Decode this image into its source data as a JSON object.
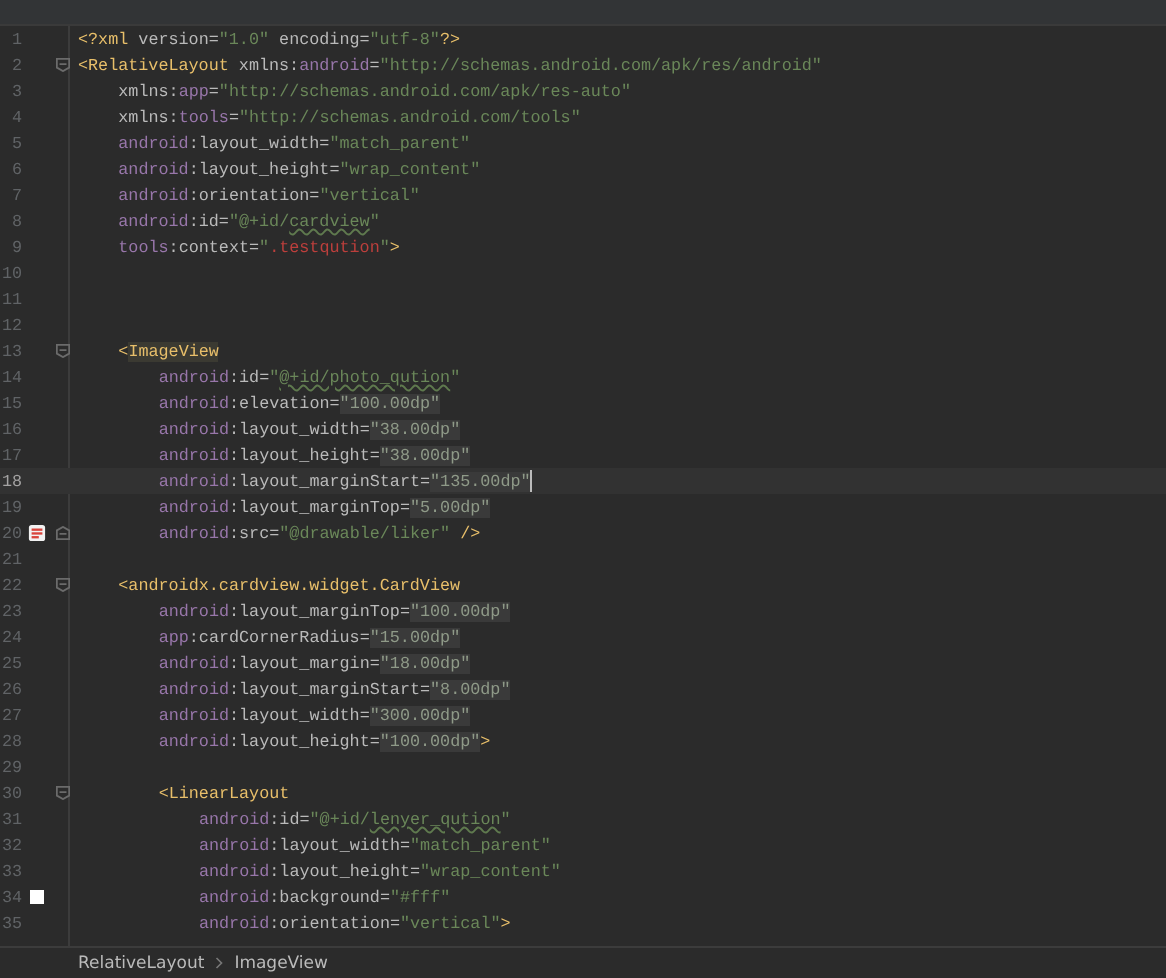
{
  "editor": {
    "lines": [
      {
        "number": "1",
        "kind": "plain",
        "current": false,
        "tokens": [
          {
            "kind": "tag",
            "text": "<?xml"
          },
          {
            "kind": "attr",
            "text": " version="
          },
          {
            "kind": "value",
            "text": "\"1.0\""
          },
          {
            "kind": "attr",
            "text": " encoding="
          },
          {
            "kind": "value",
            "text": "\"utf-8\""
          },
          {
            "kind": "tag",
            "text": "?>"
          }
        ]
      },
      {
        "number": "2",
        "kind": "opening",
        "current": false,
        "tokens": [
          {
            "kind": "tag",
            "text": "<RelativeLayout"
          },
          {
            "kind": "attr",
            "text": " xmlns:"
          },
          {
            "kind": "ns",
            "text": "android"
          },
          {
            "kind": "attr",
            "text": "="
          },
          {
            "kind": "value",
            "text": "\"http://schemas.android.com/apk/res/android\""
          }
        ],
        "children": [
          {
            "number": "3",
            "kind": "plain",
            "current": false,
            "tokens": [
              {
                "kind": "attr",
                "text": "xmlns:"
              },
              {
                "kind": "ns",
                "text": "app"
              },
              {
                "kind": "attr",
                "text": "="
              },
              {
                "kind": "value",
                "text": "\"http://schemas.android.com/apk/res-auto\""
              }
            ]
          },
          {
            "number": "4",
            "kind": "plain",
            "current": false,
            "tokens": [
              {
                "kind": "attr",
                "text": "xmlns:"
              },
              {
                "kind": "ns",
                "text": "tools"
              },
              {
                "kind": "attr",
                "text": "="
              },
              {
                "kind": "value",
                "text": "\"http://schemas.android.com/tools\""
              }
            ]
          },
          {
            "number": "5",
            "kind": "plain",
            "current": false,
            "tokens": [
              {
                "kind": "ns",
                "text": "android"
              },
              {
                "kind": "attr",
                "text": ":layout_width="
              },
              {
                "kind": "value",
                "text": "\"match_parent\""
              }
            ]
          },
          {
            "number": "6",
            "kind": "plain",
            "current": false,
            "tokens": [
              {
                "kind": "ns",
                "text": "android"
              },
              {
                "kind": "attr",
                "text": ":layout_height="
              },
              {
                "kind": "value",
                "text": "\"wrap_content\""
              }
            ]
          },
          {
            "number": "7",
            "kind": "plain",
            "current": false,
            "tokens": [
              {
                "kind": "ns",
                "text": "android"
              },
              {
                "kind": "attr",
                "text": ":orientation="
              },
              {
                "kind": "value",
                "text": "\"vertical\""
              }
            ]
          },
          {
            "number": "8",
            "kind": "plain",
            "current": false,
            "tokens": [
              {
                "kind": "ns",
                "text": "android"
              },
              {
                "kind": "attr",
                "text": ":id="
              },
              {
                "kind": "value",
                "text": "\"@+id/"
              },
              {
                "kind": "typo",
                "text": "cardview"
              },
              {
                "kind": "value",
                "text": "\""
              }
            ]
          },
          {
            "number": "9",
            "kind": "plain",
            "current": false,
            "tokens": [
              {
                "kind": "ns",
                "text": "tools"
              },
              {
                "kind": "attr",
                "text": ":context="
              },
              {
                "kind": "value",
                "text": "\""
              },
              {
                "kind": "error",
                "text": ".testqution"
              },
              {
                "kind": "value",
                "text": "\""
              },
              {
                "kind": "tag",
                "text": ">"
              }
            ]
          },
          {
            "number": "10",
            "kind": "plain",
            "current": false
          },
          {
            "number": "11",
            "kind": "plain",
            "current": false
          },
          {
            "number": "12",
            "kind": "plain",
            "current": false
          },
          {
            "number": "13",
            "kind": "opening",
            "current": false,
            "tokens": [
              {
                "kind": "tag",
                "text": "<"
              },
              {
                "kind": "tag-matched",
                "text": "ImageView"
              }
            ],
            "children": [
              {
                "number": "14",
                "kind": "plain",
                "current": false,
                "tokens": [
                  {
                    "kind": "ns",
                    "text": "android"
                  },
                  {
                    "kind": "attr",
                    "text": ":id="
                  },
                  {
                    "kind": "value",
                    "text": "\""
                  },
                  {
                    "kind": "typo",
                    "text": "@+id/photo_qution"
                  },
                  {
                    "kind": "value",
                    "text": "\""
                  }
                ]
              },
              {
                "number": "15",
                "kind": "plain",
                "current": false,
                "tokens": [
                  {
                    "kind": "ns",
                    "text": "android"
                  },
                  {
                    "kind": "attr",
                    "text": ":elevation="
                  },
                  {
                    "kind": "value-hardcoded",
                    "text": "\"100.00dp\""
                  }
                ]
              },
              {
                "number": "16",
                "kind": "plain",
                "current": false,
                "tokens": [
                  {
                    "kind": "ns",
                    "text": "android"
                  },
                  {
                    "kind": "attr",
                    "text": ":layout_width="
                  },
                  {
                    "kind": "value-hardcoded",
                    "text": "\"38.00dp\""
                  }
                ]
              },
              {
                "number": "17",
                "kind": "plain",
                "current": false,
                "tokens": [
                  {
                    "kind": "ns",
                    "text": "android"
                  },
                  {
                    "kind": "attr",
                    "text": ":layout_height="
                  },
                  {
                    "kind": "value-hardcoded",
                    "text": "\"38.00dp\""
                  }
                ]
              },
              {
                "number": "18",
                "kind": "plain",
                "current": true,
                "tokens": [
                  {
                    "kind": "ns",
                    "text": "android"
                  },
                  {
                    "kind": "attr",
                    "text": ":layout_marginStart="
                  },
                  {
                    "kind": "value-hardcoded",
                    "text": "\"135.00dp\""
                  }
                ]
              },
              {
                "number": "19",
                "kind": "plain",
                "current": false,
                "tokens": [
                  {
                    "kind": "ns",
                    "text": "android"
                  },
                  {
                    "kind": "attr",
                    "text": ":layout_marginTop="
                  },
                  {
                    "kind": "value-hardcoded",
                    "text": "\"5.00dp\""
                  }
                ]
              },
              {
                "number": "20",
                "kind": "image",
                "current": false,
                "tokens": [
                  {
                    "kind": "ns",
                    "text": "android"
                  },
                  {
                    "kind": "attr",
                    "text": ":src="
                  },
                  {
                    "kind": "value",
                    "text": "\"@drawable/liker\""
                  },
                  {
                    "kind": "tag",
                    "text": " />"
                  }
                ]
              }
            ]
          },
          {
            "number": "21",
            "kind": "plain",
            "current": false
          },
          {
            "number": "22",
            "kind": "opening",
            "current": false,
            "tokens": [
              {
                "kind": "tag",
                "text": "<androidx.cardview.widget.CardView"
              }
            ],
            "children": [
              {
                "number": "23",
                "kind": "plain",
                "current": false,
                "tokens": [
                  {
                    "kind": "ns",
                    "text": "android"
                  },
                  {
                    "kind": "attr",
                    "text": ":layout_marginTop="
                  },
                  {
                    "kind": "value-hardcoded",
                    "text": "\"100.00dp\""
                  }
                ]
              },
              {
                "number": "24",
                "kind": "plain",
                "current": false,
                "tokens": [
                  {
                    "kind": "ns",
                    "text": "app"
                  },
                  {
                    "kind": "attr",
                    "text": ":cardCornerRadius="
                  },
                  {
                    "kind": "value-hardcoded",
                    "text": "\"15.00dp\""
                  }
                ]
              },
              {
                "number": "25",
                "kind": "plain",
                "current": false,
                "tokens": [
                  {
                    "kind": "ns",
                    "text": "android"
                  },
                  {
                    "kind": "attr",
                    "text": ":layout_margin="
                  },
                  {
                    "kind": "value-hardcoded",
                    "text": "\"18.00dp\""
                  }
                ]
              },
              {
                "number": "26",
                "kind": "plain",
                "current": false,
                "tokens": [
                  {
                    "kind": "ns",
                    "text": "android"
                  },
                  {
                    "kind": "attr",
                    "text": ":layout_marginStart="
                  },
                  {
                    "kind": "value-hardcoded",
                    "text": "\"8.00dp\""
                  }
                ]
              },
              {
                "number": "27",
                "kind": "plain",
                "current": false,
                "tokens": [
                  {
                    "kind": "ns",
                    "text": "android"
                  },
                  {
                    "kind": "attr",
                    "text": ":layout_width="
                  },
                  {
                    "kind": "value-hardcoded",
                    "text": "\"300.00dp\""
                  }
                ]
              },
              {
                "number": "28",
                "kind": "plain",
                "current": false,
                "tokens": [
                  {
                    "kind": "ns",
                    "text": "android"
                  },
                  {
                    "kind": "attr",
                    "text": ":layout_height="
                  },
                  {
                    "kind": "value-hardcoded",
                    "text": "\"100.00dp\""
                  },
                  {
                    "kind": "tag",
                    "text": ">"
                  }
                ]
              },
              {
                "number": "29",
                "kind": "plain",
                "current": false
              },
              {
                "number": "30",
                "kind": "opening",
                "current": false,
                "tokens": [
                  {
                    "kind": "tag",
                    "text": "<LinearLayout"
                  }
                ],
                "children": [
                  {
                    "number": "31",
                    "kind": "plain",
                    "current": false,
                    "tokens": [
                      {
                        "kind": "ns",
                        "text": "android"
                      },
                      {
                        "kind": "attr",
                        "text": ":id="
                      },
                      {
                        "kind": "value",
                        "text": "\"@+id/"
                      },
                      {
                        "kind": "typo",
                        "text": "lenyer_qution"
                      },
                      {
                        "kind": "value",
                        "text": "\""
                      }
                    ]
                  },
                  {
                    "number": "32",
                    "kind": "plain",
                    "current": false,
                    "tokens": [
                      {
                        "kind": "ns",
                        "text": "android"
                      },
                      {
                        "kind": "attr",
                        "text": ":layout_width="
                      },
                      {
                        "kind": "value",
                        "text": "\"match_parent\""
                      }
                    ]
                  },
                  {
                    "number": "33",
                    "kind": "plain",
                    "current": false,
                    "tokens": [
                      {
                        "kind": "ns",
                        "text": "android"
                      },
                      {
                        "kind": "attr",
                        "text": ":layout_height="
                      },
                      {
                        "kind": "value",
                        "text": "\"wrap_content\""
                      }
                    ]
                  },
                  {
                    "number": "34",
                    "kind": "swatch",
                    "current": false,
                    "color": "#ffffff",
                    "tokens": [
                      {
                        "kind": "ns",
                        "text": "android"
                      },
                      {
                        "kind": "attr",
                        "text": ":background="
                      },
                      {
                        "kind": "value",
                        "text": "\"#fff\""
                      }
                    ]
                  },
                  {
                    "number": "35",
                    "kind": "plain",
                    "current": false,
                    "tokens": [
                      {
                        "kind": "ns",
                        "text": "android"
                      },
                      {
                        "kind": "attr",
                        "text": ":orientation="
                      },
                      {
                        "kind": "value",
                        "text": "\"vertical\""
                      },
                      {
                        "kind": "tag",
                        "text": ">"
                      }
                    ]
                  }
                ]
              }
            ]
          }
        ]
      }
    ]
  },
  "breadcrumb": [
    "RelativeLayout",
    "ImageView"
  ]
}
